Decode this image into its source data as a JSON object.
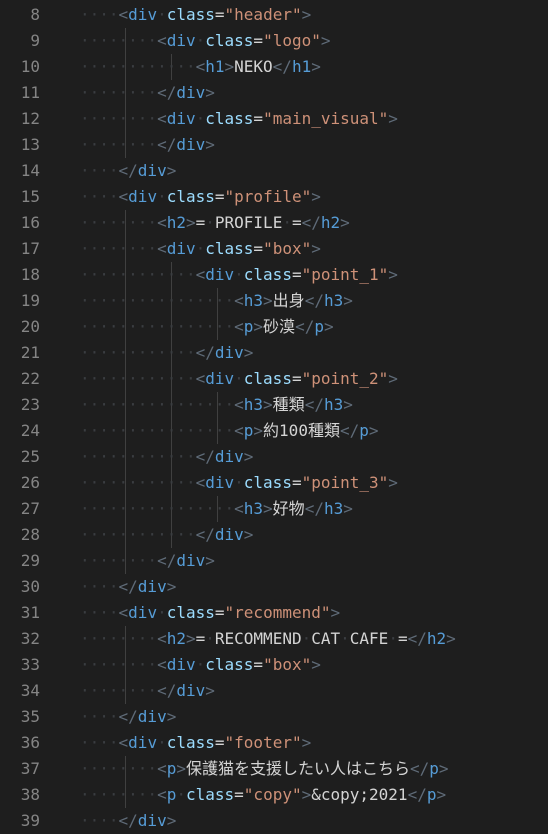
{
  "editor": {
    "lines": [
      {
        "num": "8",
        "indent": 1,
        "parts": [
          [
            "tk",
            "<"
          ],
          [
            "tg",
            "div"
          ],
          [
            "ws",
            "·"
          ],
          [
            "at",
            "class"
          ],
          [
            "eq",
            "="
          ],
          [
            "st",
            "\"header\""
          ],
          [
            "tk",
            ">"
          ]
        ]
      },
      {
        "num": "9",
        "indent": 2,
        "parts": [
          [
            "tk",
            "<"
          ],
          [
            "tg",
            "div"
          ],
          [
            "ws",
            "·"
          ],
          [
            "at",
            "class"
          ],
          [
            "eq",
            "="
          ],
          [
            "st",
            "\"logo\""
          ],
          [
            "tk",
            ">"
          ]
        ]
      },
      {
        "num": "10",
        "indent": 3,
        "parts": [
          [
            "tk",
            "<"
          ],
          [
            "tg",
            "h1"
          ],
          [
            "tk",
            ">"
          ],
          [
            "tx",
            "NEKO"
          ],
          [
            "tk",
            "</"
          ],
          [
            "tg",
            "h1"
          ],
          [
            "tk",
            ">"
          ]
        ]
      },
      {
        "num": "11",
        "indent": 2,
        "parts": [
          [
            "tk",
            "</"
          ],
          [
            "tg",
            "div"
          ],
          [
            "tk",
            ">"
          ]
        ]
      },
      {
        "num": "12",
        "indent": 2,
        "parts": [
          [
            "tk",
            "<"
          ],
          [
            "tg",
            "div"
          ],
          [
            "ws",
            "·"
          ],
          [
            "at",
            "class"
          ],
          [
            "eq",
            "="
          ],
          [
            "st",
            "\"main_visual\""
          ],
          [
            "tk",
            ">"
          ]
        ]
      },
      {
        "num": "13",
        "indent": 2,
        "parts": [
          [
            "tk",
            "</"
          ],
          [
            "tg",
            "div"
          ],
          [
            "tk",
            ">"
          ]
        ]
      },
      {
        "num": "14",
        "indent": 1,
        "parts": [
          [
            "tk",
            "</"
          ],
          [
            "tg",
            "div"
          ],
          [
            "tk",
            ">"
          ]
        ]
      },
      {
        "num": "15",
        "indent": 1,
        "parts": [
          [
            "tk",
            "<"
          ],
          [
            "tg",
            "div"
          ],
          [
            "ws",
            "·"
          ],
          [
            "at",
            "class"
          ],
          [
            "eq",
            "="
          ],
          [
            "st",
            "\"profile\""
          ],
          [
            "tk",
            ">"
          ]
        ]
      },
      {
        "num": "16",
        "indent": 2,
        "parts": [
          [
            "tk",
            "<"
          ],
          [
            "tg",
            "h2"
          ],
          [
            "tk",
            ">"
          ],
          [
            "tx",
            "="
          ],
          [
            "ws",
            "·"
          ],
          [
            "tx",
            "PROFILE"
          ],
          [
            "ws",
            "·"
          ],
          [
            "tx",
            "="
          ],
          [
            "tk",
            "</"
          ],
          [
            "tg",
            "h2"
          ],
          [
            "tk",
            ">"
          ]
        ]
      },
      {
        "num": "17",
        "indent": 2,
        "parts": [
          [
            "tk",
            "<"
          ],
          [
            "tg",
            "div"
          ],
          [
            "ws",
            "·"
          ],
          [
            "at",
            "class"
          ],
          [
            "eq",
            "="
          ],
          [
            "st",
            "\"box\""
          ],
          [
            "tk",
            ">"
          ]
        ]
      },
      {
        "num": "18",
        "indent": 3,
        "parts": [
          [
            "tk",
            "<"
          ],
          [
            "tg",
            "div"
          ],
          [
            "ws",
            "·"
          ],
          [
            "at",
            "class"
          ],
          [
            "eq",
            "="
          ],
          [
            "st",
            "\"point_1\""
          ],
          [
            "tk",
            ">"
          ]
        ]
      },
      {
        "num": "19",
        "indent": 4,
        "parts": [
          [
            "tk",
            "<"
          ],
          [
            "tg",
            "h3"
          ],
          [
            "tk",
            ">"
          ],
          [
            "tx",
            "出身"
          ],
          [
            "tk",
            "</"
          ],
          [
            "tg",
            "h3"
          ],
          [
            "tk",
            ">"
          ]
        ]
      },
      {
        "num": "20",
        "indent": 4,
        "parts": [
          [
            "tk",
            "<"
          ],
          [
            "tg",
            "p"
          ],
          [
            "tk",
            ">"
          ],
          [
            "tx",
            "砂漠"
          ],
          [
            "tk",
            "</"
          ],
          [
            "tg",
            "p"
          ],
          [
            "tk",
            ">"
          ]
        ]
      },
      {
        "num": "21",
        "indent": 3,
        "parts": [
          [
            "tk",
            "</"
          ],
          [
            "tg",
            "div"
          ],
          [
            "tk",
            ">"
          ]
        ]
      },
      {
        "num": "22",
        "indent": 3,
        "parts": [
          [
            "tk",
            "<"
          ],
          [
            "tg",
            "div"
          ],
          [
            "ws",
            "·"
          ],
          [
            "at",
            "class"
          ],
          [
            "eq",
            "="
          ],
          [
            "st",
            "\"point_2\""
          ],
          [
            "tk",
            ">"
          ]
        ]
      },
      {
        "num": "23",
        "indent": 4,
        "parts": [
          [
            "tk",
            "<"
          ],
          [
            "tg",
            "h3"
          ],
          [
            "tk",
            ">"
          ],
          [
            "tx",
            "種類"
          ],
          [
            "tk",
            "</"
          ],
          [
            "tg",
            "h3"
          ],
          [
            "tk",
            ">"
          ]
        ]
      },
      {
        "num": "24",
        "indent": 4,
        "parts": [
          [
            "tk",
            "<"
          ],
          [
            "tg",
            "p"
          ],
          [
            "tk",
            ">"
          ],
          [
            "tx",
            "約100種類"
          ],
          [
            "tk",
            "</"
          ],
          [
            "tg",
            "p"
          ],
          [
            "tk",
            ">"
          ]
        ]
      },
      {
        "num": "25",
        "indent": 3,
        "parts": [
          [
            "tk",
            "</"
          ],
          [
            "tg",
            "div"
          ],
          [
            "tk",
            ">"
          ]
        ]
      },
      {
        "num": "26",
        "indent": 3,
        "parts": [
          [
            "tk",
            "<"
          ],
          [
            "tg",
            "div"
          ],
          [
            "ws",
            "·"
          ],
          [
            "at",
            "class"
          ],
          [
            "eq",
            "="
          ],
          [
            "st",
            "\"point_3\""
          ],
          [
            "tk",
            ">"
          ]
        ]
      },
      {
        "num": "27",
        "indent": 4,
        "parts": [
          [
            "tk",
            "<"
          ],
          [
            "tg",
            "h3"
          ],
          [
            "tk",
            ">"
          ],
          [
            "tx",
            "好物"
          ],
          [
            "tk",
            "</"
          ],
          [
            "tg",
            "h3"
          ],
          [
            "tk",
            ">"
          ]
        ]
      },
      {
        "num": "28",
        "indent": 3,
        "parts": [
          [
            "tk",
            "</"
          ],
          [
            "tg",
            "div"
          ],
          [
            "tk",
            ">"
          ]
        ]
      },
      {
        "num": "29",
        "indent": 2,
        "parts": [
          [
            "tk",
            "</"
          ],
          [
            "tg",
            "div"
          ],
          [
            "tk",
            ">"
          ]
        ]
      },
      {
        "num": "30",
        "indent": 1,
        "parts": [
          [
            "tk",
            "</"
          ],
          [
            "tg",
            "div"
          ],
          [
            "tk",
            ">"
          ]
        ]
      },
      {
        "num": "31",
        "indent": 1,
        "parts": [
          [
            "tk",
            "<"
          ],
          [
            "tg",
            "div"
          ],
          [
            "ws",
            "·"
          ],
          [
            "at",
            "class"
          ],
          [
            "eq",
            "="
          ],
          [
            "st",
            "\"recommend\""
          ],
          [
            "tk",
            ">"
          ]
        ]
      },
      {
        "num": "32",
        "indent": 2,
        "parts": [
          [
            "tk",
            "<"
          ],
          [
            "tg",
            "h2"
          ],
          [
            "tk",
            ">"
          ],
          [
            "tx",
            "="
          ],
          [
            "ws",
            "·"
          ],
          [
            "tx",
            "RECOMMEND"
          ],
          [
            "ws",
            "·"
          ],
          [
            "tx",
            "CAT"
          ],
          [
            "ws",
            "·"
          ],
          [
            "tx",
            "CAFE"
          ],
          [
            "ws",
            "·"
          ],
          [
            "tx",
            "="
          ],
          [
            "tk",
            "</"
          ],
          [
            "tg",
            "h2"
          ],
          [
            "tk",
            ">"
          ]
        ]
      },
      {
        "num": "33",
        "indent": 2,
        "parts": [
          [
            "tk",
            "<"
          ],
          [
            "tg",
            "div"
          ],
          [
            "ws",
            "·"
          ],
          [
            "at",
            "class"
          ],
          [
            "eq",
            "="
          ],
          [
            "st",
            "\"box\""
          ],
          [
            "tk",
            ">"
          ]
        ]
      },
      {
        "num": "34",
        "indent": 2,
        "parts": [
          [
            "tk",
            "</"
          ],
          [
            "tg",
            "div"
          ],
          [
            "tk",
            ">"
          ]
        ]
      },
      {
        "num": "35",
        "indent": 1,
        "parts": [
          [
            "tk",
            "</"
          ],
          [
            "tg",
            "div"
          ],
          [
            "tk",
            ">"
          ]
        ]
      },
      {
        "num": "36",
        "indent": 1,
        "parts": [
          [
            "tk",
            "<"
          ],
          [
            "tg",
            "div"
          ],
          [
            "ws",
            "·"
          ],
          [
            "at",
            "class"
          ],
          [
            "eq",
            "="
          ],
          [
            "st",
            "\"footer\""
          ],
          [
            "tk",
            ">"
          ]
        ]
      },
      {
        "num": "37",
        "indent": 2,
        "parts": [
          [
            "tk",
            "<"
          ],
          [
            "tg",
            "p"
          ],
          [
            "tk",
            ">"
          ],
          [
            "tx",
            "保護猫を支援したい人はこちら"
          ],
          [
            "tk",
            "</"
          ],
          [
            "tg",
            "p"
          ],
          [
            "tk",
            ">"
          ]
        ]
      },
      {
        "num": "38",
        "indent": 2,
        "parts": [
          [
            "tk",
            "<"
          ],
          [
            "tg",
            "p"
          ],
          [
            "ws",
            "·"
          ],
          [
            "at",
            "class"
          ],
          [
            "eq",
            "="
          ],
          [
            "st",
            "\"copy\""
          ],
          [
            "tk",
            ">"
          ],
          [
            "tx",
            "&copy;2021"
          ],
          [
            "tk",
            "</"
          ],
          [
            "tg",
            "p"
          ],
          [
            "tk",
            ">"
          ]
        ]
      },
      {
        "num": "39",
        "indent": 1,
        "parts": [
          [
            "tk",
            "</"
          ],
          [
            "tg",
            "div"
          ],
          [
            "tk",
            ">"
          ]
        ]
      }
    ]
  },
  "colors": {
    "background": "#1e1e1e",
    "line_number": "#858585",
    "tag": "#569cd6",
    "attribute": "#9cdcfe",
    "string": "#ce9178",
    "text": "#d4d4d4",
    "bracket": "#5f6b78",
    "whitespace_dot": "#3a3d41"
  }
}
